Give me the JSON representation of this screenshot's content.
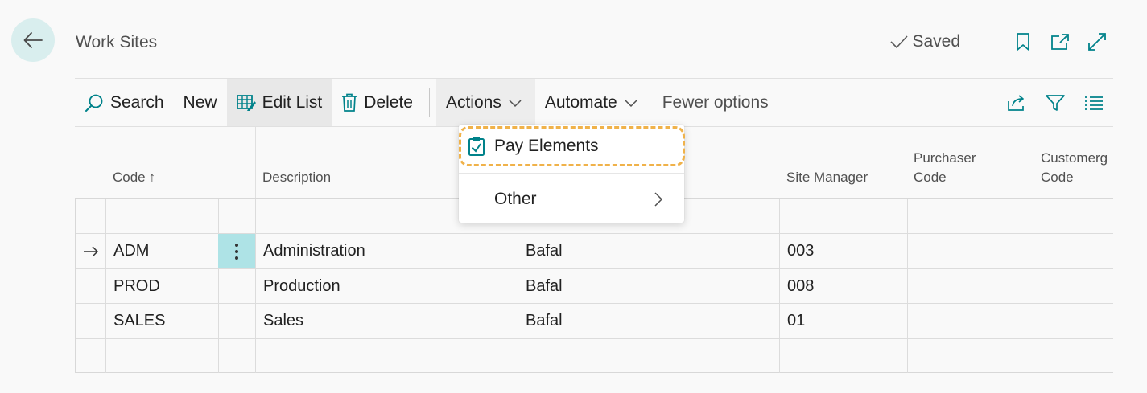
{
  "page": {
    "title": "Work Sites",
    "saved_label": "Saved"
  },
  "toolbar": {
    "search_label": "Search",
    "new_label": "New",
    "edit_list_label": "Edit List",
    "delete_label": "Delete",
    "actions_label": "Actions",
    "automate_label": "Automate",
    "fewer_options_label": "Fewer options"
  },
  "actions_menu": {
    "items": [
      {
        "label": "Pay Elements",
        "icon": "clipboard-check-icon"
      },
      {
        "label": "Other",
        "icon": "chevron-right-icon"
      }
    ]
  },
  "table": {
    "columns": [
      {
        "label": "Code",
        "sort": "↑"
      },
      {
        "label": "Description"
      },
      {
        "label": "Site Manager"
      },
      {
        "label_line1": "Purchaser",
        "label_line2": "Code"
      },
      {
        "label_line1": "Customerg",
        "label_line2": "Code"
      }
    ],
    "rows": [
      {
        "code": "ADM",
        "description": "Administration",
        "name": "Bafal",
        "site_manager": "003",
        "selected": true
      },
      {
        "code": "PROD",
        "description": "Production",
        "name": "Bafal",
        "site_manager": "008"
      },
      {
        "code": "SALES",
        "description": "Sales",
        "name": "Bafal",
        "site_manager": "01"
      }
    ]
  },
  "colors": {
    "accent": "#00a3a8",
    "highlight_outline": "#f0b24a",
    "row_menu_bg": "#aee3e6",
    "back_button_bg": "#d9eeee"
  }
}
